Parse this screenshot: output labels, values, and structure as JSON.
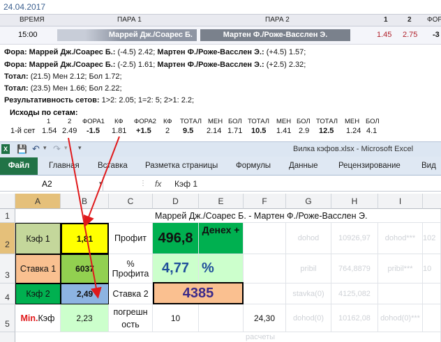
{
  "date": "24.04.2017",
  "match_table": {
    "headers": [
      "ВРЕМЯ",
      "ПАРА 1",
      "ПАРА 2",
      "1",
      "2",
      "ФОР"
    ],
    "row": {
      "time": "15:00",
      "pair1": "Маррей Дж./Соарес Б.",
      "pair2": "Мартен Ф./Роже-Васслен Э.",
      "odd1": "1.45",
      "odd2": "2.75",
      "fora": "-3"
    }
  },
  "info_lines": {
    "line1_label": "Фора: Маррей Дж./Соарес Б.:",
    "line1_val": " (-4.5) 2.42; ",
    "line1_label2": "Мартен Ф./Роже-Васслен Э.:",
    "line1_val2": " (+4.5) 1.57;",
    "line2_label": "Фора: Маррей Дж./Соарес Б.:",
    "line2_val": " (-2.5) 1.61; ",
    "line2_label2": "Мартен Ф./Роже-Васслен Э.:",
    "line2_val2": " (+2.5) 2.32;",
    "line3_label": "Тотал:",
    "line3_val": " (21.5) Мен 2.12; Бол 1.72;",
    "line4_label": "Тотал:",
    "line4_val": " (23.5) Мен 1.66; Бол 2.22;",
    "line5_label": "Результативность сетов:",
    "line5_val": " 1>2: 2.05; 1=2: 5; 2>1: 2.2;"
  },
  "sets_table": {
    "title": "Исходы по сетам:",
    "headers": [
      "1",
      "2",
      "ФОРА1",
      "КФ",
      "ФОРА2",
      "КФ",
      "ТОТАЛ",
      "МЕН",
      "БОЛ",
      "ТОТАЛ",
      "МЕН",
      "БОЛ",
      "ТОТАЛ",
      "МЕН",
      "БОЛ"
    ],
    "row_label": "1-й сет",
    "values": [
      "1.54",
      "2.49",
      "-1.5",
      "1.81",
      "+1.5",
      "2",
      "9.5",
      "2.14",
      "1.71",
      "10.5",
      "1.41",
      "2.9",
      "12.5",
      "1.24",
      "4.1"
    ]
  },
  "excel": {
    "title": "Вилка кэфов.xlsx  -  Microsoft Excel",
    "tabs": [
      "Файл",
      "Главная",
      "Вставка",
      "Разметка страницы",
      "Формулы",
      "Данные",
      "Рецензирование",
      "Вид"
    ],
    "name_box": "A2",
    "fx": "fx",
    "formula": "Кэф 1",
    "columns": [
      "A",
      "B",
      "C",
      "D",
      "E",
      "F",
      "G",
      "H",
      "I"
    ],
    "rows": [
      "1",
      "2",
      "3",
      "4",
      "5"
    ],
    "cells": {
      "d1": "Маррей Дж./Соарес Б.  - Мартен Ф./Роже-Васслен Э.",
      "a2": "Кэф 1",
      "b2": "1,81",
      "c2": "Профит",
      "d2": "496,8",
      "e2": "Денех +",
      "g2": "dohod",
      "h2": "10926,97",
      "i2": "dohod***",
      "j2": "102",
      "a3": "Ставка 1",
      "b3": "6037",
      "c3": "% Профита",
      "d3": "4,77",
      "e3": "%",
      "g3": "pribil",
      "h3": "764,8879",
      "i3": "pribil***",
      "j3": "10",
      "a4": "Кэф 2",
      "b4": "2,49",
      "c4": "Ставка 2",
      "d4": "4385",
      "g4": "stavka(0)",
      "h4": "4125,082",
      "a5_red": "Min.",
      "a5": " Кэф",
      "b5": "2,23",
      "c5": "погрешн ость",
      "d5": "10",
      "f5": "24,30",
      "g5": "dohod(0)",
      "h5": "10162,08",
      "i5": "dohod(0)***",
      "bottom": "расчеты"
    }
  },
  "colors": {
    "green": "#92d050",
    "yellow": "#ffff00",
    "dark_green": "#00b050",
    "light_green": "#ccffcc",
    "orange": "#fac090",
    "blue": "#8db4e2",
    "red_arrow": "#e0191b"
  }
}
